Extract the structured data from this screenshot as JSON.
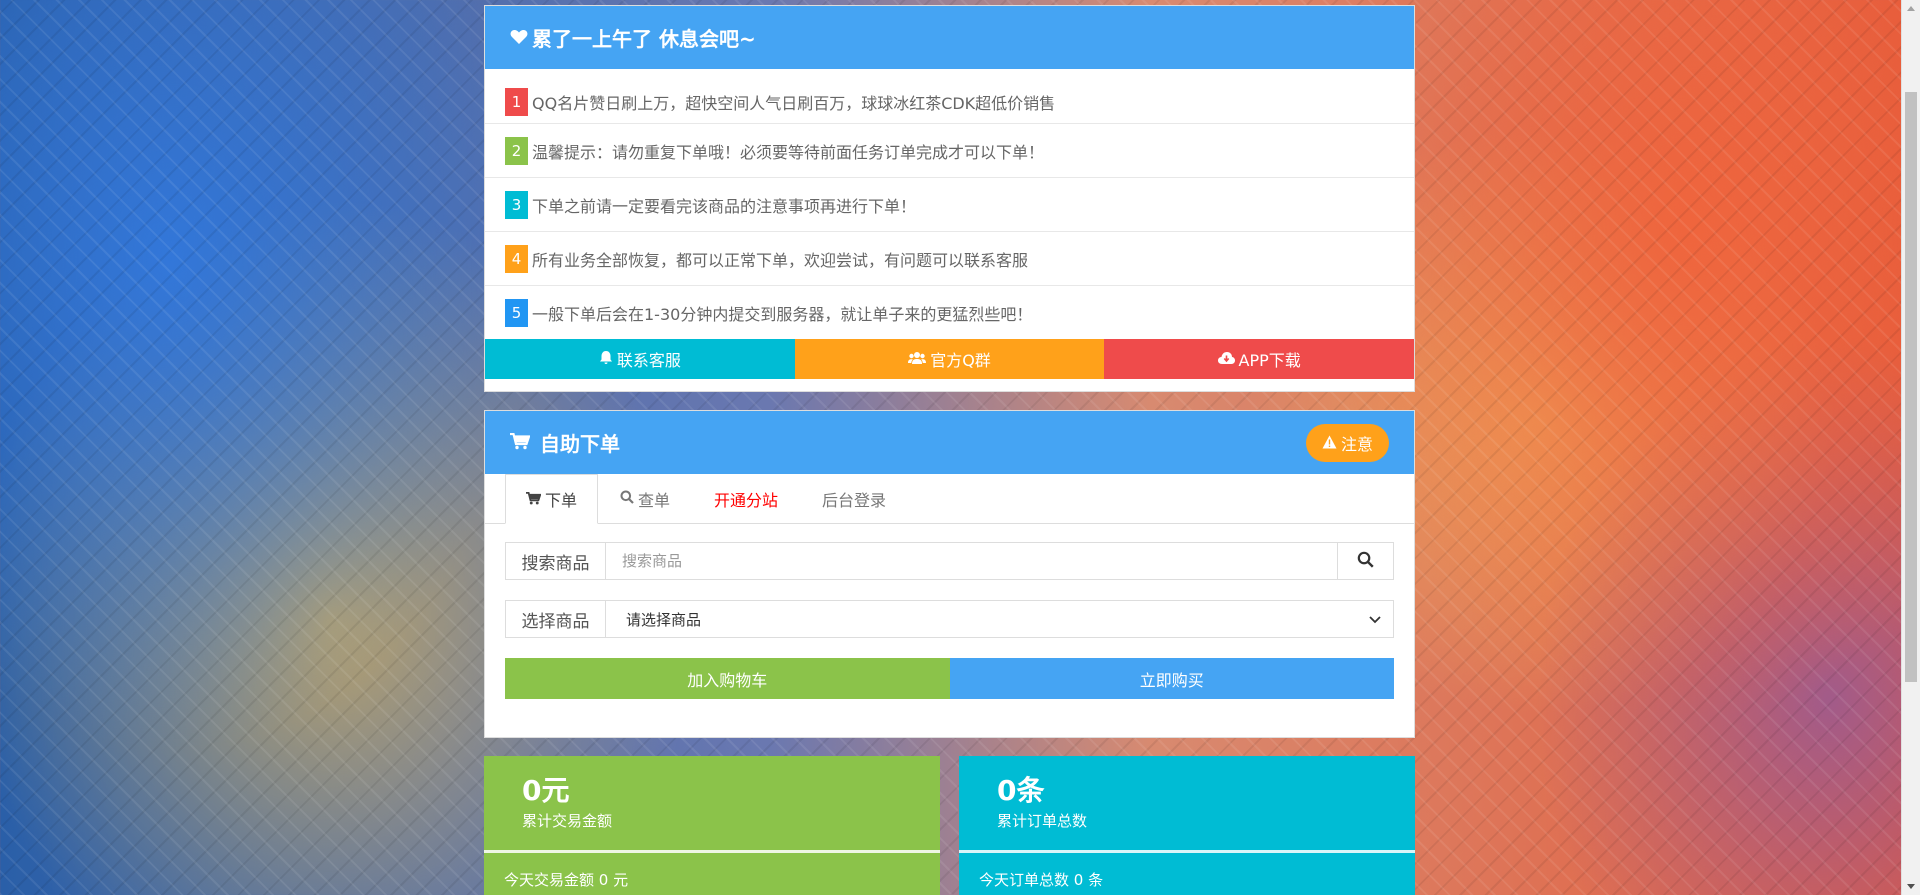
{
  "colors": {
    "primary": "#45a4f3",
    "green": "#8bc34a",
    "cyan": "#00bcd4",
    "orange": "#ffa11a",
    "red": "#ef4b4b",
    "blue": "#2196f3"
  },
  "notice": {
    "title": "累了一上午了 休息会吧~",
    "items": [
      {
        "num": "1",
        "text": "QQ名片赞日刷上万，超快空间人气日刷百万，球球冰红茶CDK超低价销售"
      },
      {
        "num": "2",
        "text": "温馨提示：请勿重复下单哦！必须要等待前面任务订单完成才可以下单！"
      },
      {
        "num": "3",
        "text": "下单之前请一定要看完该商品的注意事项再进行下单！"
      },
      {
        "num": "4",
        "text": "所有业务全部恢复，都可以正常下单，欢迎尝试，有问题可以联系客服"
      },
      {
        "num": "5",
        "text": "一般下单后会在1-30分钟内提交到服务器，就让单子来的更猛烈些吧！"
      }
    ],
    "buttons": {
      "contact": "联系客服",
      "qq_group": "官方Q群",
      "app_download": "APP下载"
    }
  },
  "order": {
    "title": "自助下单",
    "warn_label": "注意",
    "tabs": {
      "order": "下单",
      "query": "查单",
      "substation": "开通分站",
      "admin": "后台登录"
    },
    "search": {
      "label": "搜索商品",
      "placeholder": "搜索商品"
    },
    "select": {
      "label": "选择商品",
      "value": "请选择商品"
    },
    "add_to_cart": "加入购物车",
    "buy_now": "立即购买"
  },
  "stats": {
    "amount": {
      "value": "0元",
      "label": "累计交易金额",
      "today": "今天交易金额 0 元"
    },
    "orders": {
      "value": "0条",
      "label": "累计订单总数",
      "today": "今天订单总数 0 条"
    }
  }
}
